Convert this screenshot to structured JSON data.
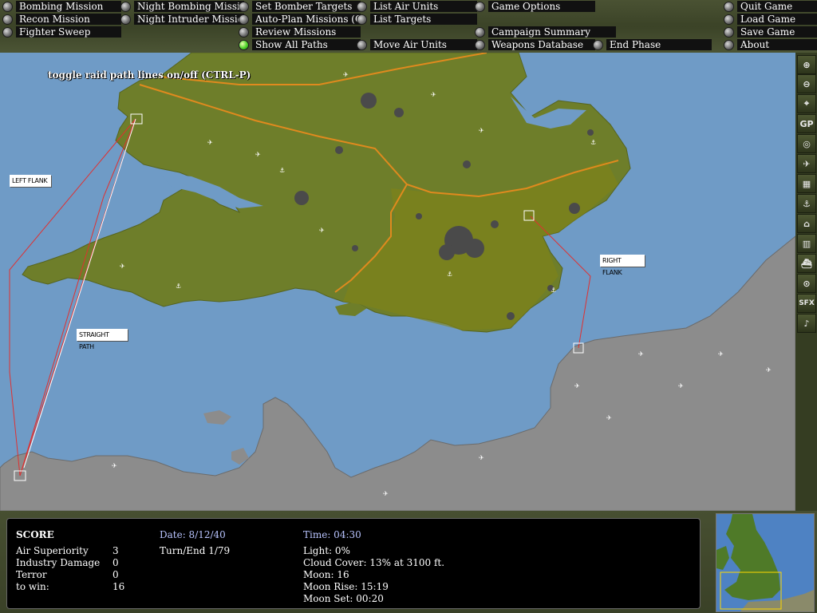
{
  "menu": {
    "bombing_mission": "Bombing Mission",
    "recon_mission": "Recon Mission",
    "fighter_sweep": "Fighter Sweep",
    "night_bombing_mission": "Night Bombing Mission",
    "night_intruder_mission": "Night Intruder Mission",
    "set_bomber_targets": "Set Bomber Targets",
    "auto_plan_missions": "Auto-Plan Missions (Off)",
    "review_missions": "Review Missions",
    "show_all_paths": "Show All Paths",
    "list_air_units": "List Air Units",
    "list_targets": "List Targets",
    "move_air_units": "Move Air Units",
    "game_options": "Game Options",
    "campaign_summary": "Campaign Summary",
    "weapons_database": "Weapons Database",
    "end_phase": "End Phase",
    "quit_game": "Quit Game",
    "load_game": "Load Game",
    "save_game": "Save Game",
    "about": "About"
  },
  "map": {
    "tooltip": "toggle raid path lines on/off (CTRL-P)",
    "left_flank": "LEFT FLANK",
    "straight_path": "STRAIGHT PATH",
    "right_flank": "RIGHT FLANK"
  },
  "toolbar": {
    "gp_label": "GP",
    "sfx_label": "SFX"
  },
  "score": {
    "title": "SCORE",
    "air_superiority_label": "Air Superiority",
    "air_superiority_value": "3",
    "industry_damage_label": "Industry Damage",
    "industry_damage_value": "0",
    "terror_label": "Terror",
    "terror_value": "0",
    "to_win_label": "to win:",
    "to_win_value": "16"
  },
  "status": {
    "date": "Date: 8/12/40",
    "turn": "Turn/End 1/79",
    "time": "Time: 04:30",
    "light": "Light: 0%",
    "cloud_cover": "Cloud Cover: 13% at 3100 ft.",
    "moon": "Moon: 16",
    "moon_rise": "Moon Rise: 15:19",
    "moon_set": "Moon Set: 00:20"
  },
  "colors": {
    "sea": "#6f9bc6",
    "england": "#6e7e2a",
    "continent": "#8c8c8c",
    "border": "#e08a1e",
    "raid_path": "#e03030"
  }
}
